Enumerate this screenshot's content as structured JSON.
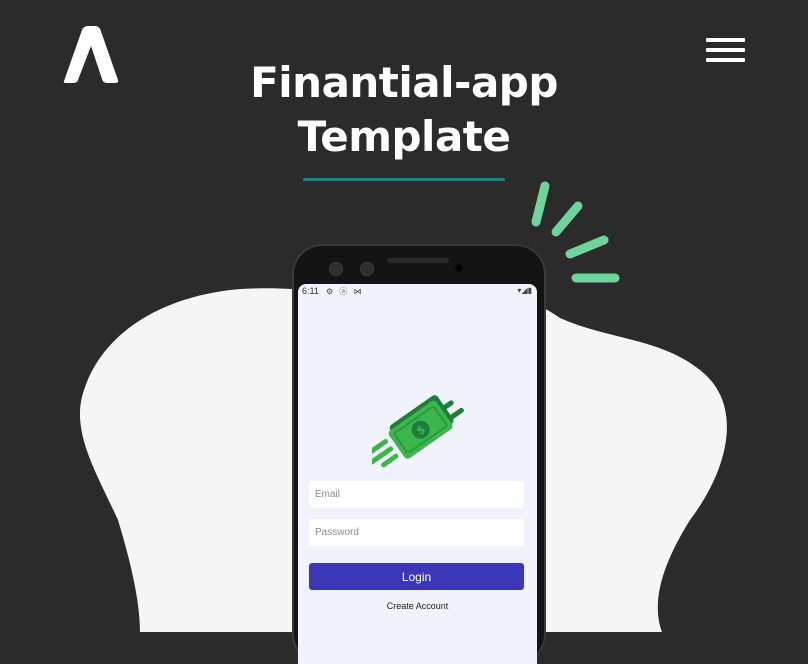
{
  "brand": {
    "logo_icon": "brand-a-logo-icon"
  },
  "header": {
    "title_line1": "Finantial-app",
    "title_line2": "Template",
    "menu_icon": "hamburger-menu-icon"
  },
  "colors": {
    "background": "#2b2b2b",
    "accent_underline": "#0e8a8a",
    "sparkle": "#6fd39a",
    "blob": "#f5f5f5",
    "login_button": "#3b37b8",
    "screen_bg": "#f0f3fb",
    "money_green": "#3cb54a",
    "money_dark": "#1e7d3c"
  },
  "phone": {
    "status": {
      "time": "6:11",
      "left_icons": "⚙ ⓐ ⋈",
      "right_icons": "▾◢▮"
    },
    "app_icon": "flying-money-icon",
    "email": {
      "placeholder": "Email",
      "value": ""
    },
    "password": {
      "placeholder": "Password",
      "value": ""
    },
    "login_label": "Login",
    "create_account_label": "Create Account"
  }
}
